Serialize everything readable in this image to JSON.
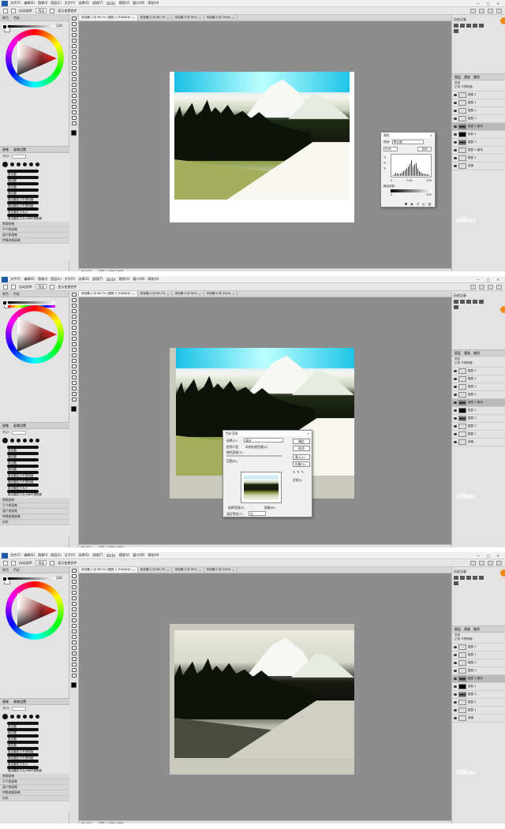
{
  "menu": {
    "items": [
      "文件(F)",
      "编辑(E)",
      "图像(I)",
      "图层(L)",
      "文字(Y)",
      "选择(S)",
      "滤镜(T)",
      "3D(D)",
      "视图(V)",
      "窗口(W)",
      "帮助(H)"
    ],
    "window_buttons": [
      "—",
      "□",
      "✕"
    ]
  },
  "options": {
    "auto_select": "自动选择:",
    "auto_select_value": "图层",
    "show_transform": "显示变换控件"
  },
  "left_panel": {
    "tabs": [
      "颜色",
      "色板"
    ],
    "hue_value": "128"
  },
  "brushes": {
    "tabs": [
      "画笔",
      "画笔设置"
    ],
    "size_label": "大小:",
    "dot_sizes": [
      "30",
      "25",
      "25",
      "25",
      "25",
      "30"
    ],
    "items": [
      "柔边圆",
      "硬边圆",
      "柔边圆",
      "硬边圆",
      "柔边圆压力不透明度",
      "硬边圆压力不透明度",
      "柔边圆压力大小",
      "柔边圆压力大小和不透明度"
    ],
    "groups": [
      "常规画笔",
      "干介质画笔",
      "湿介质画笔",
      "特殊效果画笔",
      "水彩"
    ]
  },
  "tabs": [
    "未标题-1 @ 66.7% (图层 2, RGB/8#)",
    "未标题-2 @ 66.7%",
    "未标题-3 @ 50%",
    "未标题-4 @ 100%"
  ],
  "status": [
    "66.67%",
    "文档:1.26M/2.96M"
  ],
  "right_panel": {
    "top_title": "历史记录",
    "layers_tabs": [
      "图层",
      "通道",
      "路径"
    ],
    "kind_label": "类型",
    "blend_label": "正常",
    "opacity_label": "不透明度:",
    "fill_label": "填充:",
    "layers": [
      "图层 2",
      "图层 1",
      "图层 4",
      "图层 5",
      "图层 3 副本",
      "色阶 1",
      "图层 3",
      "图层 2 副本",
      "图层 2",
      "图层 1",
      "背景"
    ]
  },
  "frame1_dialog": {
    "title": "属性",
    "preset_label": "预设:",
    "preset_value": "默认值",
    "channel": "RGB",
    "auto": "自动",
    "values": [
      "0",
      "1.00",
      "255"
    ],
    "output_label": "输出色阶:",
    "output_values": [
      "0",
      "255"
    ]
  },
  "frame2_dialog": {
    "title": "色彩范围",
    "select_label": "选择(C):",
    "select_value": "高光",
    "detect_faces": "检测人脸",
    "localized": "本地化颜色簇(Z)",
    "fuzziness_label": "颜色容差(F):",
    "range_label": "范围(R):",
    "radio1": "选择范围(E)",
    "radio2": "图像(M)",
    "selection_preview_label": "选区预览(T):",
    "selection_preview_value": "无",
    "buttons": [
      "确定",
      "取消",
      "载入(L)...",
      "存储(S)..."
    ],
    "invert": "反相(I)"
  },
  "watermark": "Uiiiuu"
}
